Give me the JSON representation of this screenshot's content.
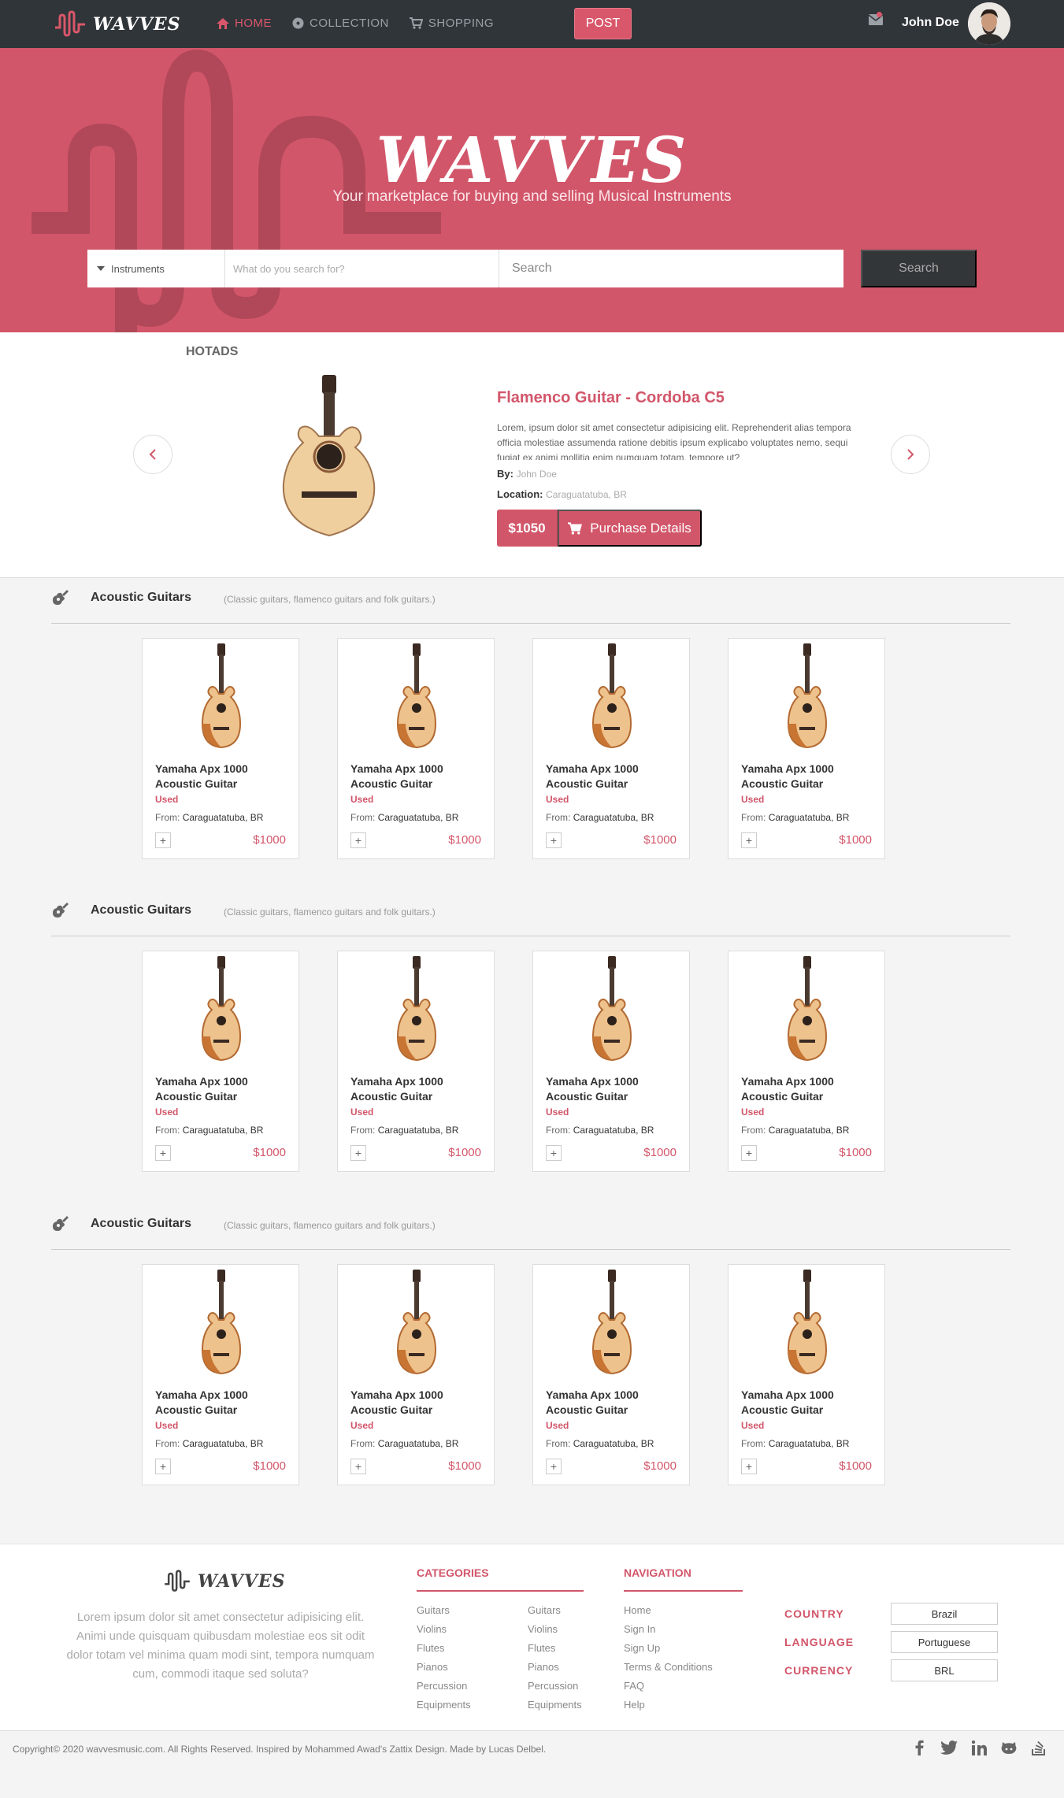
{
  "nav": {
    "logo": "WAVVES",
    "links": [
      {
        "label": "HOME",
        "icon": "home-icon",
        "active": true
      },
      {
        "label": "COLLECTION",
        "icon": "disc-icon",
        "active": false
      },
      {
        "label": "SHOPPING",
        "icon": "cart-icon",
        "active": false
      }
    ],
    "post_label": "POST",
    "user_name": "John Doe"
  },
  "hero": {
    "title": "WAVVES",
    "subtitle": "Your marketplace for buying and selling Musical Instruments",
    "search": {
      "category": "Instruments",
      "what_placeholder": "What do you search for?",
      "main_placeholder": "Search",
      "button": "Search"
    }
  },
  "hotads": {
    "label": "HOTADS",
    "title": "Flamenco Guitar - Cordoba C5",
    "description": "Lorem, ipsum dolor sit amet consectetur adipisicing elit. Reprehenderit alias tempora officia molestiae assumenda ratione debitis ipsum explicabo voluptates nemo, sequi fugiat ex animi mollitia enim numquam totam, tempore ut?",
    "by_label": "By:",
    "by_value": "John Doe",
    "location_label": "Location:",
    "location_value": "Caraguatatuba, BR",
    "price": "$1050",
    "purchase_label": "Purchase Details"
  },
  "categories": [
    {
      "title": "Acoustic Guitars",
      "subtitle": "(Classic guitars, flamenco guitars and folk guitars.)",
      "products": [
        {
          "name": "Yamaha Apx 1000 Acoustic Guitar",
          "condition": "Used",
          "from_label": "From:",
          "from": "Caraguatatuba, BR",
          "price": "$1000"
        },
        {
          "name": "Yamaha Apx 1000 Acoustic Guitar",
          "condition": "Used",
          "from_label": "From:",
          "from": "Caraguatatuba, BR",
          "price": "$1000"
        },
        {
          "name": "Yamaha Apx 1000 Acoustic Guitar",
          "condition": "Used",
          "from_label": "From:",
          "from": "Caraguatatuba, BR",
          "price": "$1000"
        },
        {
          "name": "Yamaha Apx 1000 Acoustic Guitar",
          "condition": "Used",
          "from_label": "From:",
          "from": "Caraguatatuba, BR",
          "price": "$1000"
        }
      ]
    },
    {
      "title": "Acoustic Guitars",
      "subtitle": "(Classic guitars, flamenco guitars and folk guitars.)",
      "products": [
        {
          "name": "Yamaha Apx 1000 Acoustic Guitar",
          "condition": "Used",
          "from_label": "From:",
          "from": "Caraguatatuba, BR",
          "price": "$1000"
        },
        {
          "name": "Yamaha Apx 1000 Acoustic Guitar",
          "condition": "Used",
          "from_label": "From:",
          "from": "Caraguatatuba, BR",
          "price": "$1000"
        },
        {
          "name": "Yamaha Apx 1000 Acoustic Guitar",
          "condition": "Used",
          "from_label": "From:",
          "from": "Caraguatatuba, BR",
          "price": "$1000"
        },
        {
          "name": "Yamaha Apx 1000 Acoustic Guitar",
          "condition": "Used",
          "from_label": "From:",
          "from": "Caraguatatuba, BR",
          "price": "$1000"
        }
      ]
    },
    {
      "title": "Acoustic Guitars",
      "subtitle": "(Classic guitars, flamenco guitars and folk guitars.)",
      "products": [
        {
          "name": "Yamaha Apx 1000 Acoustic Guitar",
          "condition": "Used",
          "from_label": "From:",
          "from": "Caraguatatuba, BR",
          "price": "$1000"
        },
        {
          "name": "Yamaha Apx 1000 Acoustic Guitar",
          "condition": "Used",
          "from_label": "From:",
          "from": "Caraguatatuba, BR",
          "price": "$1000"
        },
        {
          "name": "Yamaha Apx 1000 Acoustic Guitar",
          "condition": "Used",
          "from_label": "From:",
          "from": "Caraguatatuba, BR",
          "price": "$1000"
        },
        {
          "name": "Yamaha Apx 1000 Acoustic Guitar",
          "condition": "Used",
          "from_label": "From:",
          "from": "Caraguatatuba, BR",
          "price": "$1000"
        }
      ]
    }
  ],
  "footer": {
    "logo": "WAVVES",
    "about": "Lorem ipsum dolor sit amet consectetur adipisicing elit. Animi unde quisquam quibusdam molestiae eos sit odit dolor totam vel minima quam modi sint, tempora numquam cum, commodi itaque sed soluta?",
    "categories_title": "CATEGORIES",
    "categories_col1": [
      "Guitars",
      "Violins",
      "Flutes",
      "Pianos",
      "Percussion",
      "Equipments"
    ],
    "categories_col2": [
      "Guitars",
      "Violins",
      "Flutes",
      "Pianos",
      "Percussion",
      "Equipments"
    ],
    "navigation_title": "NAVIGATION",
    "navigation": [
      "Home",
      "Sign In",
      "Sign Up",
      "Terms & Conditions",
      "FAQ",
      "Help"
    ],
    "settings": [
      {
        "label": "COUNTRY",
        "value": "Brazil"
      },
      {
        "label": "LANGUAGE",
        "value": "Portuguese"
      },
      {
        "label": "CURRENCY",
        "value": "BRL"
      }
    ],
    "copyright": "Copyright© 2020 wavvesmusic.com. All Rights Reserved. Inspired by Mohammed Awad's Zattix Design. Made by Lucas Delbel.",
    "socials": [
      "facebook-icon",
      "twitter-icon",
      "linkedin-icon",
      "github-icon",
      "stackoverflow-icon"
    ]
  },
  "colors": {
    "brand": "#d2566a",
    "navbar": "#30353a",
    "search_button": "#333638"
  }
}
